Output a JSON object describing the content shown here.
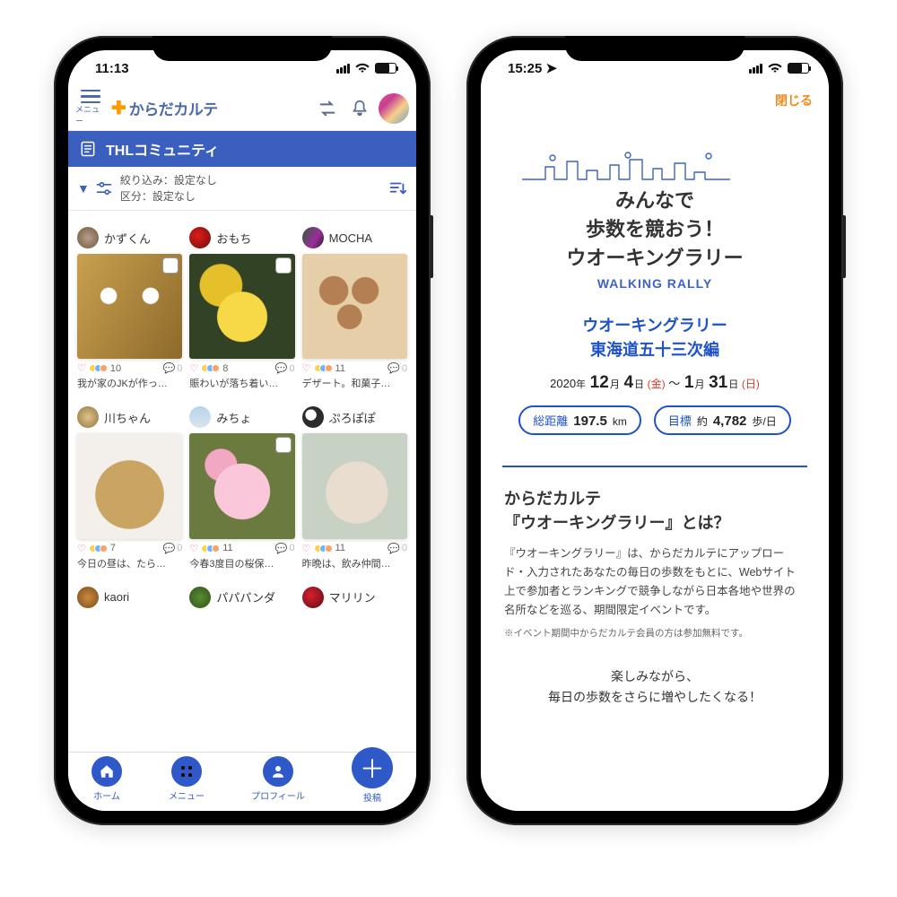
{
  "left": {
    "status_time": "11:13",
    "menu_label": "メニュー",
    "brand": "からだカルテ",
    "community_title": "THLコミュニティ",
    "filter_line1": "絞り込み：設定なし",
    "filter_line2": "区分：設定なし",
    "posts_row1": [
      {
        "user": "かずくん",
        "likes": "10",
        "comments": "0",
        "caption": "我が家のJKが作っ…"
      },
      {
        "user": "おもち",
        "likes": "8",
        "comments": "0",
        "caption": "賑わいが落ち着い…"
      },
      {
        "user": "MOCHA",
        "likes": "11",
        "comments": "0",
        "caption": "デザート。和菓子…"
      }
    ],
    "posts_row2": [
      {
        "user": "川ちゃん",
        "likes": "7",
        "comments": "0",
        "caption": "今日の昼は、たら…"
      },
      {
        "user": "みちょ",
        "likes": "11",
        "comments": "0",
        "caption": "今春3度目の桜保…"
      },
      {
        "user": "ぷろぽぽ",
        "likes": "11",
        "comments": "0",
        "caption": "昨晩は、飲み仲間…"
      }
    ],
    "posts_row3": [
      {
        "user": "kaori"
      },
      {
        "user": "パパパンダ"
      },
      {
        "user": "マリリン"
      }
    ],
    "tabs": {
      "home": "ホーム",
      "menu": "メニュー",
      "profile": "プロフィール",
      "post": "投稿"
    }
  },
  "right": {
    "status_time": "15:25",
    "close": "閉じる",
    "headline_l1": "みんなで",
    "headline_l2": "歩数を競おう！",
    "headline_l3": "ウオーキングラリー",
    "subtitle": "WALKING RALLY",
    "course_l1": "ウオーキングラリー",
    "course_l2": "東海道五十三次編",
    "date": {
      "year": "2020",
      "m1": "12",
      "d1": "4",
      "dow1": "(金)",
      "sep": "〜",
      "m2": "1",
      "d2": "31",
      "dow2": "(日)",
      "y_suf": "年",
      "m_suf": "月",
      "d_suf": "日"
    },
    "pill_dist_label": "総距離",
    "pill_dist_value": "197.5",
    "pill_dist_unit": "km",
    "pill_goal_label": "目標",
    "pill_goal_prefix": "約",
    "pill_goal_value": "4,782",
    "pill_goal_unit": "歩/日",
    "question_l1": "からだカルテ",
    "question_l2": "『ウオーキングラリー』とは？",
    "body": "『ウオーキングラリー』は、からだカルテにアップロード・入力されたあなたの毎日の歩数をもとに、Webサイト上で参加者とランキングで競争しながら日本各地や世界の名所などを巡る、期間限定イベントです。",
    "note": "※イベント期間中からだカルテ会員の方は参加無料です。",
    "tag_l1": "楽しみながら、",
    "tag_l2": "毎日の歩数をさらに増やしたくなる！"
  }
}
